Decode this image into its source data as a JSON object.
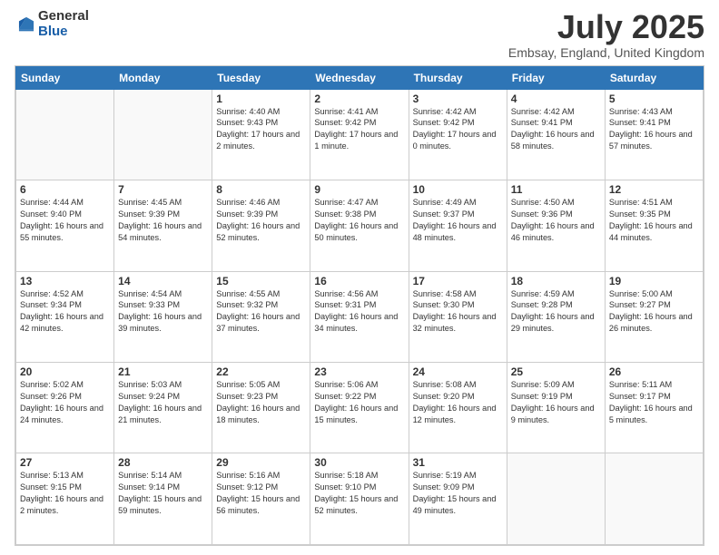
{
  "header": {
    "logo_general": "General",
    "logo_blue": "Blue",
    "month_title": "July 2025",
    "location": "Embsay, England, United Kingdom"
  },
  "weekdays": [
    "Sunday",
    "Monday",
    "Tuesday",
    "Wednesday",
    "Thursday",
    "Friday",
    "Saturday"
  ],
  "weeks": [
    [
      {
        "day": "",
        "sunrise": "",
        "sunset": "",
        "daylight": ""
      },
      {
        "day": "",
        "sunrise": "",
        "sunset": "",
        "daylight": ""
      },
      {
        "day": "1",
        "sunrise": "Sunrise: 4:40 AM",
        "sunset": "Sunset: 9:43 PM",
        "daylight": "Daylight: 17 hours and 2 minutes."
      },
      {
        "day": "2",
        "sunrise": "Sunrise: 4:41 AM",
        "sunset": "Sunset: 9:42 PM",
        "daylight": "Daylight: 17 hours and 1 minute."
      },
      {
        "day": "3",
        "sunrise": "Sunrise: 4:42 AM",
        "sunset": "Sunset: 9:42 PM",
        "daylight": "Daylight: 17 hours and 0 minutes."
      },
      {
        "day": "4",
        "sunrise": "Sunrise: 4:42 AM",
        "sunset": "Sunset: 9:41 PM",
        "daylight": "Daylight: 16 hours and 58 minutes."
      },
      {
        "day": "5",
        "sunrise": "Sunrise: 4:43 AM",
        "sunset": "Sunset: 9:41 PM",
        "daylight": "Daylight: 16 hours and 57 minutes."
      }
    ],
    [
      {
        "day": "6",
        "sunrise": "Sunrise: 4:44 AM",
        "sunset": "Sunset: 9:40 PM",
        "daylight": "Daylight: 16 hours and 55 minutes."
      },
      {
        "day": "7",
        "sunrise": "Sunrise: 4:45 AM",
        "sunset": "Sunset: 9:39 PM",
        "daylight": "Daylight: 16 hours and 54 minutes."
      },
      {
        "day": "8",
        "sunrise": "Sunrise: 4:46 AM",
        "sunset": "Sunset: 9:39 PM",
        "daylight": "Daylight: 16 hours and 52 minutes."
      },
      {
        "day": "9",
        "sunrise": "Sunrise: 4:47 AM",
        "sunset": "Sunset: 9:38 PM",
        "daylight": "Daylight: 16 hours and 50 minutes."
      },
      {
        "day": "10",
        "sunrise": "Sunrise: 4:49 AM",
        "sunset": "Sunset: 9:37 PM",
        "daylight": "Daylight: 16 hours and 48 minutes."
      },
      {
        "day": "11",
        "sunrise": "Sunrise: 4:50 AM",
        "sunset": "Sunset: 9:36 PM",
        "daylight": "Daylight: 16 hours and 46 minutes."
      },
      {
        "day": "12",
        "sunrise": "Sunrise: 4:51 AM",
        "sunset": "Sunset: 9:35 PM",
        "daylight": "Daylight: 16 hours and 44 minutes."
      }
    ],
    [
      {
        "day": "13",
        "sunrise": "Sunrise: 4:52 AM",
        "sunset": "Sunset: 9:34 PM",
        "daylight": "Daylight: 16 hours and 42 minutes."
      },
      {
        "day": "14",
        "sunrise": "Sunrise: 4:54 AM",
        "sunset": "Sunset: 9:33 PM",
        "daylight": "Daylight: 16 hours and 39 minutes."
      },
      {
        "day": "15",
        "sunrise": "Sunrise: 4:55 AM",
        "sunset": "Sunset: 9:32 PM",
        "daylight": "Daylight: 16 hours and 37 minutes."
      },
      {
        "day": "16",
        "sunrise": "Sunrise: 4:56 AM",
        "sunset": "Sunset: 9:31 PM",
        "daylight": "Daylight: 16 hours and 34 minutes."
      },
      {
        "day": "17",
        "sunrise": "Sunrise: 4:58 AM",
        "sunset": "Sunset: 9:30 PM",
        "daylight": "Daylight: 16 hours and 32 minutes."
      },
      {
        "day": "18",
        "sunrise": "Sunrise: 4:59 AM",
        "sunset": "Sunset: 9:28 PM",
        "daylight": "Daylight: 16 hours and 29 minutes."
      },
      {
        "day": "19",
        "sunrise": "Sunrise: 5:00 AM",
        "sunset": "Sunset: 9:27 PM",
        "daylight": "Daylight: 16 hours and 26 minutes."
      }
    ],
    [
      {
        "day": "20",
        "sunrise": "Sunrise: 5:02 AM",
        "sunset": "Sunset: 9:26 PM",
        "daylight": "Daylight: 16 hours and 24 minutes."
      },
      {
        "day": "21",
        "sunrise": "Sunrise: 5:03 AM",
        "sunset": "Sunset: 9:24 PM",
        "daylight": "Daylight: 16 hours and 21 minutes."
      },
      {
        "day": "22",
        "sunrise": "Sunrise: 5:05 AM",
        "sunset": "Sunset: 9:23 PM",
        "daylight": "Daylight: 16 hours and 18 minutes."
      },
      {
        "day": "23",
        "sunrise": "Sunrise: 5:06 AM",
        "sunset": "Sunset: 9:22 PM",
        "daylight": "Daylight: 16 hours and 15 minutes."
      },
      {
        "day": "24",
        "sunrise": "Sunrise: 5:08 AM",
        "sunset": "Sunset: 9:20 PM",
        "daylight": "Daylight: 16 hours and 12 minutes."
      },
      {
        "day": "25",
        "sunrise": "Sunrise: 5:09 AM",
        "sunset": "Sunset: 9:19 PM",
        "daylight": "Daylight: 16 hours and 9 minutes."
      },
      {
        "day": "26",
        "sunrise": "Sunrise: 5:11 AM",
        "sunset": "Sunset: 9:17 PM",
        "daylight": "Daylight: 16 hours and 5 minutes."
      }
    ],
    [
      {
        "day": "27",
        "sunrise": "Sunrise: 5:13 AM",
        "sunset": "Sunset: 9:15 PM",
        "daylight": "Daylight: 16 hours and 2 minutes."
      },
      {
        "day": "28",
        "sunrise": "Sunrise: 5:14 AM",
        "sunset": "Sunset: 9:14 PM",
        "daylight": "Daylight: 15 hours and 59 minutes."
      },
      {
        "day": "29",
        "sunrise": "Sunrise: 5:16 AM",
        "sunset": "Sunset: 9:12 PM",
        "daylight": "Daylight: 15 hours and 56 minutes."
      },
      {
        "day": "30",
        "sunrise": "Sunrise: 5:18 AM",
        "sunset": "Sunset: 9:10 PM",
        "daylight": "Daylight: 15 hours and 52 minutes."
      },
      {
        "day": "31",
        "sunrise": "Sunrise: 5:19 AM",
        "sunset": "Sunset: 9:09 PM",
        "daylight": "Daylight: 15 hours and 49 minutes."
      },
      {
        "day": "",
        "sunrise": "",
        "sunset": "",
        "daylight": ""
      },
      {
        "day": "",
        "sunrise": "",
        "sunset": "",
        "daylight": ""
      }
    ]
  ]
}
